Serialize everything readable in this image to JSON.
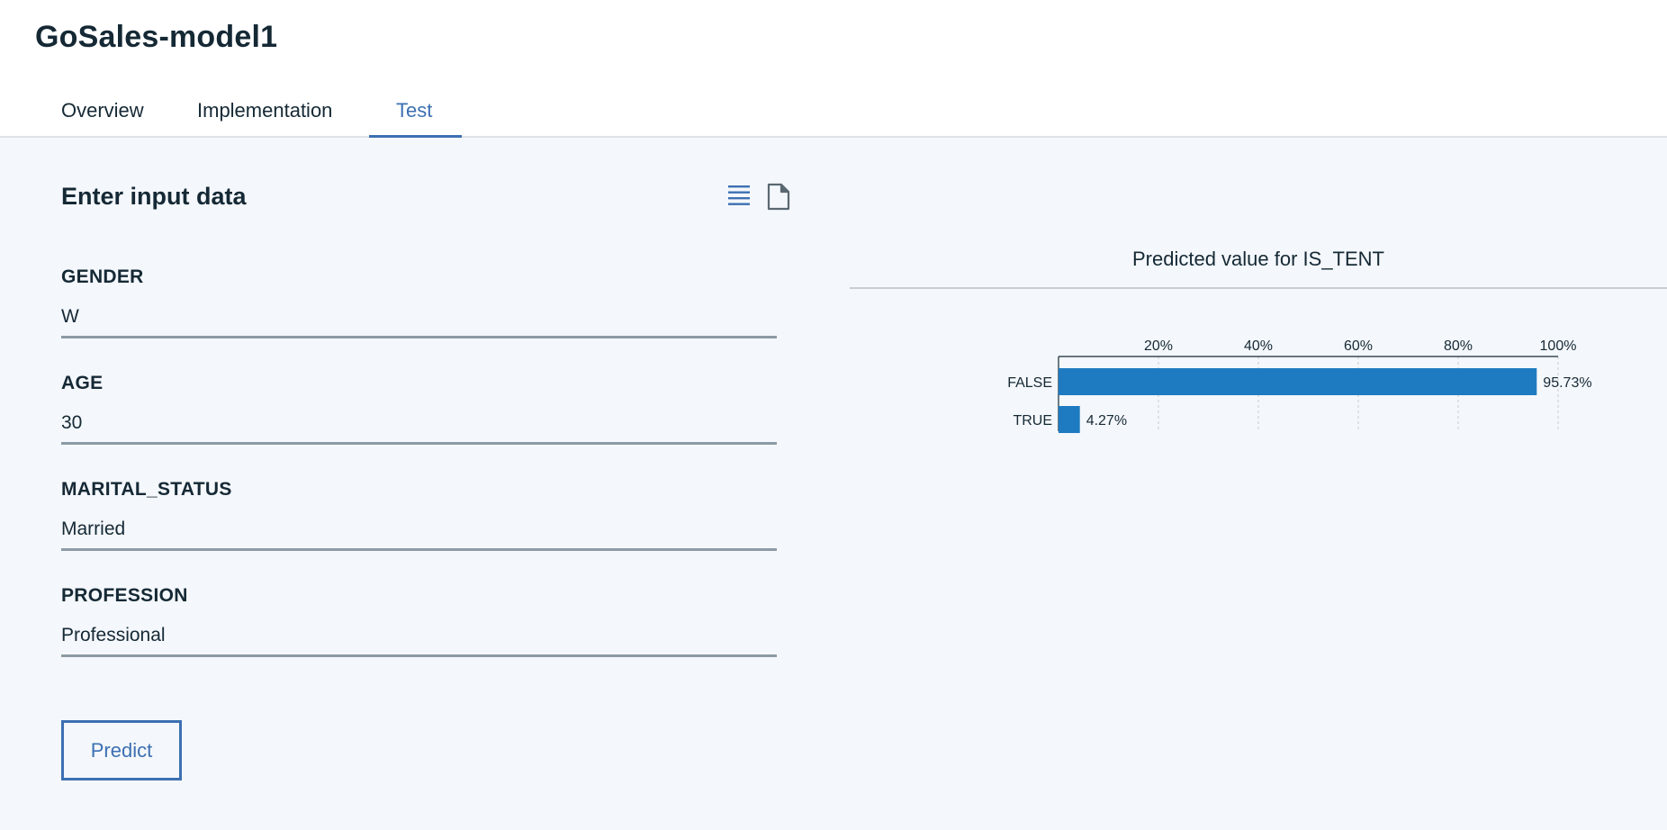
{
  "header": {
    "title": "GoSales-model1",
    "tabs": [
      {
        "label": "Overview"
      },
      {
        "label": "Implementation"
      },
      {
        "label": "Test",
        "active": true
      }
    ]
  },
  "input_panel": {
    "title": "Enter input data",
    "icons": [
      "list-view-icon",
      "file-icon"
    ],
    "fields": [
      {
        "label": "GENDER",
        "value": "W"
      },
      {
        "label": "AGE",
        "value": "30"
      },
      {
        "label": "MARITAL_STATUS",
        "value": "Married"
      },
      {
        "label": "PROFESSION",
        "value": "Professional"
      }
    ],
    "predict_label": "Predict"
  },
  "colors": {
    "accent": "#3d70b2",
    "bar": "#1e7bc1",
    "underline": "#8c9ba5"
  },
  "chart_data": {
    "type": "bar",
    "orientation": "horizontal",
    "title": "Predicted value for IS_TENT",
    "categories": [
      "FALSE",
      "TRUE"
    ],
    "values": [
      95.73,
      4.27
    ],
    "value_labels": [
      "95.73%",
      "4.27%"
    ],
    "xlim": [
      0,
      100
    ],
    "xticks": [
      20,
      40,
      60,
      80,
      100
    ],
    "xtick_labels": [
      "20%",
      "40%",
      "60%",
      "80%",
      "100%"
    ],
    "x_axis_position": "top",
    "grid": "vertical dashed",
    "xlabel": "",
    "ylabel": ""
  }
}
